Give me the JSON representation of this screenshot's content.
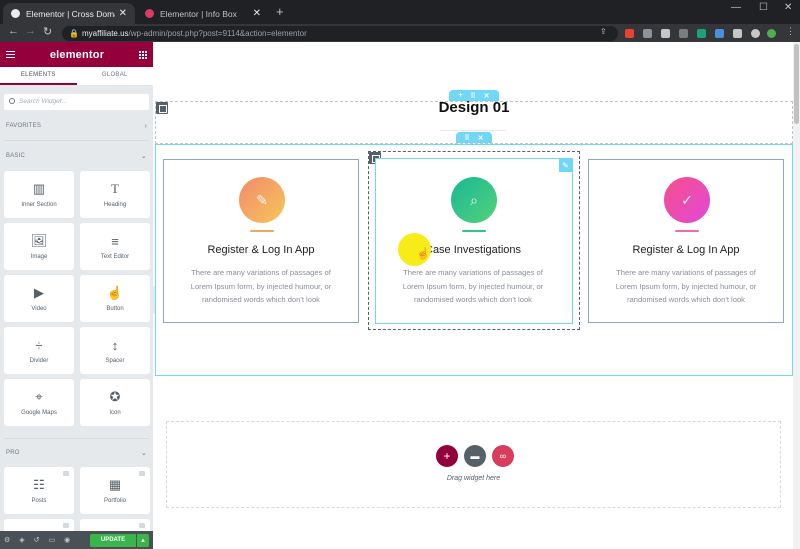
{
  "browser": {
    "tabs": [
      {
        "title": "Elementor | Cross Domain Copy Pa",
        "close": "✕",
        "active": true
      },
      {
        "title": "Elementor | Info Box",
        "close": "✕",
        "active": false
      }
    ],
    "new_tab": "+",
    "window_controls": [
      "—",
      "☐",
      "✕"
    ],
    "url_host": "myaffiliate.us",
    "url_path": "/wp-admin/post.php?post=9114&action=elementor",
    "nav": {
      "back": "←",
      "forward": "→",
      "reload": "↻"
    }
  },
  "panel": {
    "brand": "elementor",
    "tabs": [
      "ELEMENTS",
      "GLOBAL"
    ],
    "search_placeholder": "Search Widget...",
    "categories": {
      "favorites": "FAVORITES",
      "basic": "BASIC",
      "pro": "PRO"
    },
    "basic_widgets": [
      {
        "label": "Inner Section",
        "icon": "columns-icon"
      },
      {
        "label": "Heading",
        "icon": "heading-icon"
      },
      {
        "label": "Image",
        "icon": "image-icon"
      },
      {
        "label": "Text Editor",
        "icon": "text-editor-icon"
      },
      {
        "label": "Video",
        "icon": "video-icon"
      },
      {
        "label": "Button",
        "icon": "button-icon"
      },
      {
        "label": "Divider",
        "icon": "divider-icon"
      },
      {
        "label": "Spacer",
        "icon": "spacer-icon"
      },
      {
        "label": "Google Maps",
        "icon": "map-icon"
      },
      {
        "label": "Icon",
        "icon": "star-icon"
      }
    ],
    "pro_widgets": [
      {
        "label": "Posts",
        "icon": "posts-icon"
      },
      {
        "label": "Portfolio",
        "icon": "portfolio-icon"
      }
    ],
    "footer": {
      "update": "UPDATE"
    }
  },
  "canvas": {
    "heading": "Design 01",
    "cards": [
      {
        "title": "Register & Log In App",
        "description": "There are many variations of passages of Lorem Ipsum form, by injected humour, or randomised words which don't look",
        "icon": "edit-document-icon",
        "gradient_from": "#f28a6a",
        "gradient_to": "#f6c65c",
        "underline": "#f4a55e"
      },
      {
        "title": "Case Investigations",
        "description": "There are many variations of passages of Lorem Ipsum form, by injected humour, or randomised words which don't look",
        "icon": "search-icon",
        "gradient_from": "#16b896",
        "gradient_to": "#55d27a",
        "underline": "#2ec48a"
      },
      {
        "title": "Register & Log In App",
        "description": "There are many variations of passages of Lorem Ipsum form, by injected humour, or randomised words which don't look",
        "icon": "check-icon",
        "gradient_from": "#f84e8a",
        "gradient_to": "#e04ad8",
        "underline": "#f06ab0"
      }
    ],
    "drop_zone": {
      "text": "Drag widget here"
    },
    "colors": {
      "brand": "#93003c",
      "accent": "#71d7f7",
      "update_green": "#39b54a",
      "template_red": "#d63d5f"
    }
  }
}
